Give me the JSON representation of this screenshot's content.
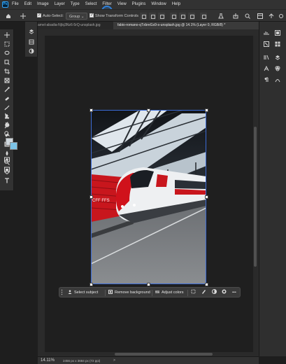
{
  "app": {
    "logo_text": "Ps"
  },
  "menu": [
    "File",
    "Edit",
    "Image",
    "Layer",
    "Type",
    "Select",
    "Filter",
    "View",
    "Plugins",
    "Window",
    "Help"
  ],
  "options_bar": {
    "auto_select_label": "Auto-Select:",
    "auto_select_value": "Group",
    "transform_controls_label": "Show Transform Controls"
  },
  "tabs": [
    {
      "label": "amel-abadia-NjIq3Nz6-5rQ-unsplash.jpg",
      "active": false
    },
    {
      "label": "fabio-romano-qTxbreGs9-s-unsplash.jpg @ 14.1% (Layer 0, RGB/8) *",
      "active": true
    }
  ],
  "photo": {
    "train_text": "CFF FFS"
  },
  "taskbar": {
    "select_subject": "Select subject",
    "remove_background": "Remove background",
    "adjust_colors": "Adjust colors",
    "more": "•••"
  },
  "status": {
    "zoom": "14.11%",
    "doc_info": "2456 px x 3684 px (72 ppi)",
    "arrow": ">"
  },
  "colors": {
    "foreground": "#cfd7dd",
    "background": "#7cc3e6",
    "accent": "#3b6bd6"
  }
}
